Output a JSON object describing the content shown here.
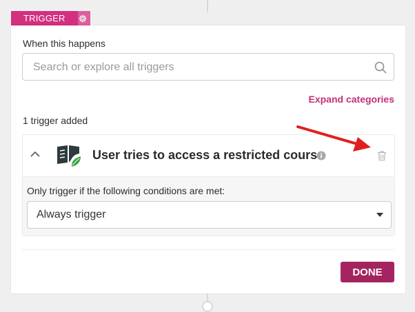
{
  "trigger_tab": {
    "label": "TRIGGER",
    "gear_icon": "gear-icon"
  },
  "panel": {
    "when_label": "When this happens",
    "search": {
      "placeholder": "Search or explore all triggers",
      "value": "",
      "icon": "search-icon"
    },
    "expand_link": "Expand categories",
    "count_label": "1 trigger added",
    "trigger": {
      "title": "User tries to access a restricted course",
      "icon": "course-book-leaf-icon",
      "conditions_label": "Only trigger if the following conditions are met:",
      "condition_value": "Always trigger"
    },
    "done_label": "DONE"
  },
  "colors": {
    "brand": "#d3307f",
    "link": "#c1307a",
    "done": "#a3245e",
    "annotation_arrow": "#e02020"
  }
}
